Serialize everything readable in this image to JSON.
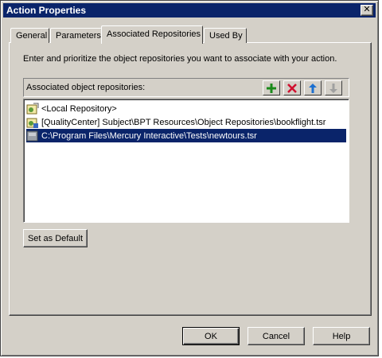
{
  "window": {
    "title": "Action Properties",
    "close_label": "✕"
  },
  "tabs": [
    {
      "label": "General"
    },
    {
      "label": "Parameters"
    },
    {
      "label": "Associated Repositories"
    },
    {
      "label": "Used By"
    }
  ],
  "panel": {
    "instructions": "Enter and prioritize the object repositories you want to associate with your action.",
    "list_label": "Associated object repositories:",
    "toolbar": {
      "add_icon": "plus-icon",
      "remove_icon": "x-icon",
      "move_up_icon": "arrow-up-icon",
      "move_down_icon": "arrow-down-icon"
    },
    "repositories": [
      {
        "label": "<Local Repository>",
        "icon": "local-repository-icon",
        "selected": false
      },
      {
        "label": "[QualityCenter] Subject\\BPT Resources\\Object Repositories\\bookflight.tsr",
        "icon": "qc-repository-icon",
        "selected": false
      },
      {
        "label": "C:\\Program Files\\Mercury Interactive\\Tests\\newtours.tsr",
        "icon": "file-repository-icon",
        "selected": true
      }
    ],
    "set_default_label": "Set as Default"
  },
  "footer": {
    "ok_label": "OK",
    "cancel_label": "Cancel",
    "help_label": "Help"
  },
  "colors": {
    "face": "#d4d0c8",
    "title_bar": "#0a246a",
    "selection": "#0a246a"
  }
}
